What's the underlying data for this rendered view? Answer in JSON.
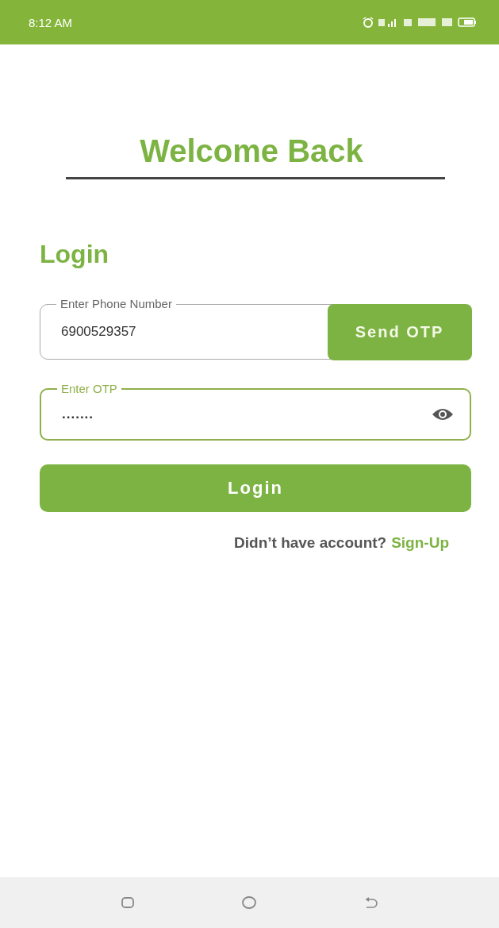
{
  "status_bar": {
    "time": "8:12 AM"
  },
  "title": "Welcome Back",
  "heading": "Login",
  "phone_field": {
    "label": "Enter Phone Number",
    "value": "6900529357"
  },
  "send_otp_button": "Send OTP",
  "otp_field": {
    "label": "Enter OTP",
    "value": ".......",
    "focused": true
  },
  "login_button": "Login",
  "signup_prompt": {
    "text": "Didn’t have account?",
    "link": "Sign-Up"
  }
}
